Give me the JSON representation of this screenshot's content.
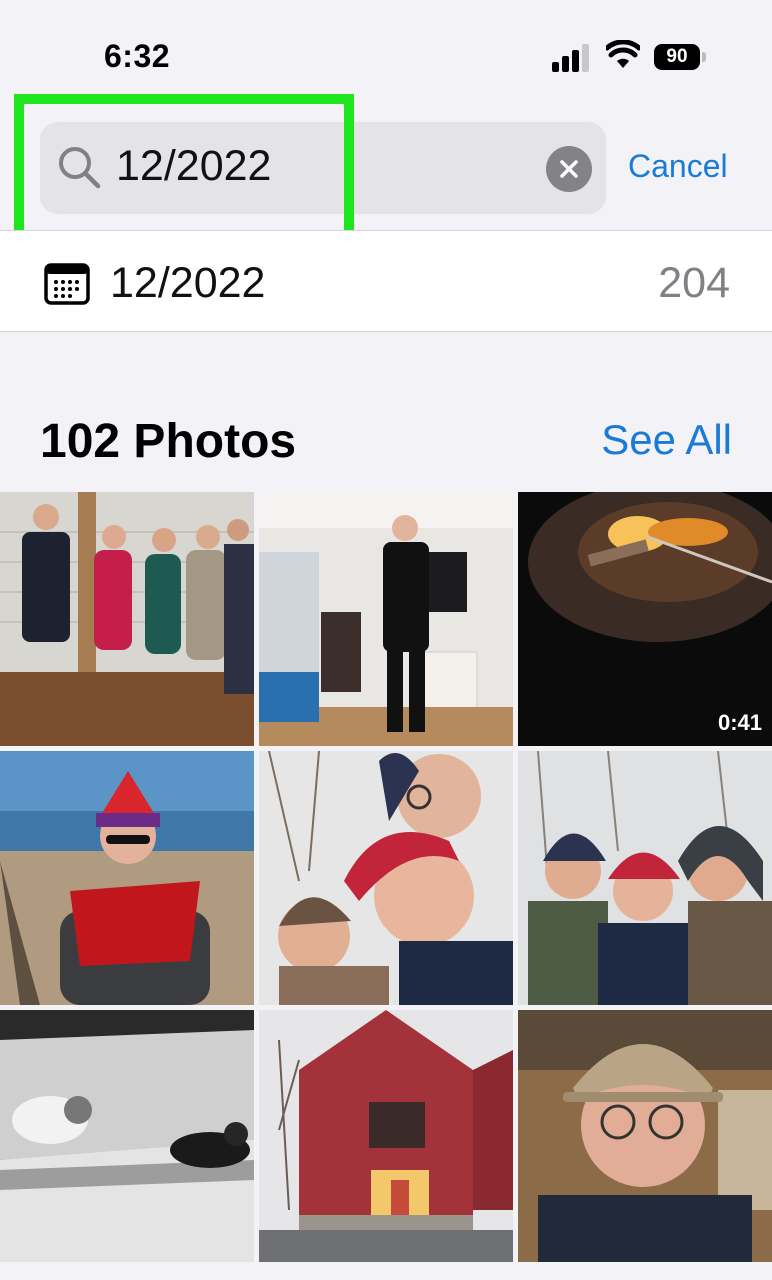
{
  "status_bar": {
    "time": "6:32",
    "battery_level": "90"
  },
  "search": {
    "query": "12/2022",
    "cancel_label": "Cancel",
    "highlight_color": "#1ee51e"
  },
  "suggestion": {
    "label": "12/2022",
    "count": "204",
    "icon": "calendar-icon"
  },
  "section": {
    "title": "102 Photos",
    "see_all_label": "See All"
  },
  "photos": [
    {
      "subject": "group of five people dressed up at a party"
    },
    {
      "subject": "man in black suit standing in hallway"
    },
    {
      "subject": "fire pit at night",
      "duration": "0:41"
    },
    {
      "subject": "woman in red hat and scarf on a beach"
    },
    {
      "subject": "selfie of three people in snow"
    },
    {
      "subject": "three people in winter hats in snowy woods"
    },
    {
      "subject": "two cats on a couch in sunlight, black and white"
    },
    {
      "subject": "red barn-style building"
    },
    {
      "subject": "man with glasses and cap selfie"
    }
  ],
  "colors": {
    "accent": "#1a7bd6",
    "background": "#f2f2f7"
  }
}
